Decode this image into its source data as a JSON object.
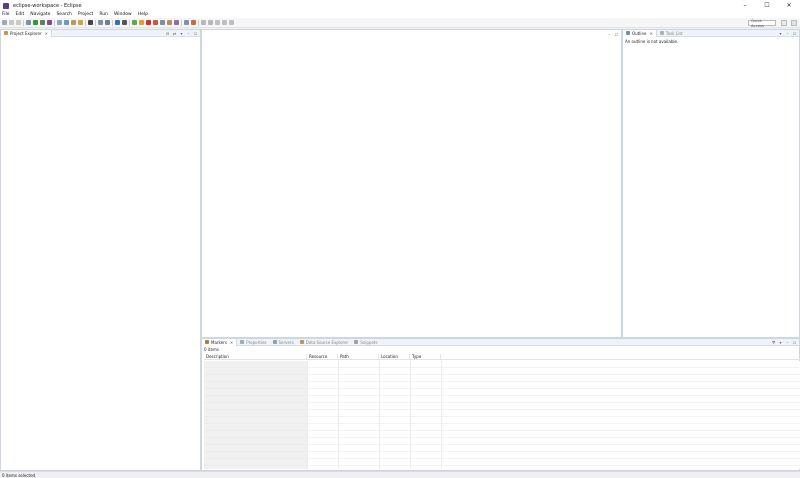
{
  "window": {
    "title": "eclipse-workspace - Eclipse",
    "minimize": "–",
    "maximize": "☐",
    "close": "✕"
  },
  "menu": [
    "File",
    "Edit",
    "Navigate",
    "Search",
    "Project",
    "Run",
    "Window",
    "Help"
  ],
  "toolbar": {
    "quick_access_placeholder": "Quick Access"
  },
  "explorer": {
    "tab_label": "Project Explorer"
  },
  "outline": {
    "tabs": [
      "Outline",
      "Task List"
    ],
    "message": "An outline is not available."
  },
  "markers": {
    "tabs": [
      "Markers",
      "Properties",
      "Servers",
      "Data Source Explorer",
      "Snippets"
    ],
    "count": "0 items",
    "columns": [
      "Description",
      "Resource",
      "Path",
      "Location",
      "Type"
    ]
  },
  "status": {
    "text": "0 items selected"
  },
  "colors": {
    "accent": "#5b3c88",
    "panel_border": "#cdd7e3",
    "panel_header": "#eef3f9"
  }
}
